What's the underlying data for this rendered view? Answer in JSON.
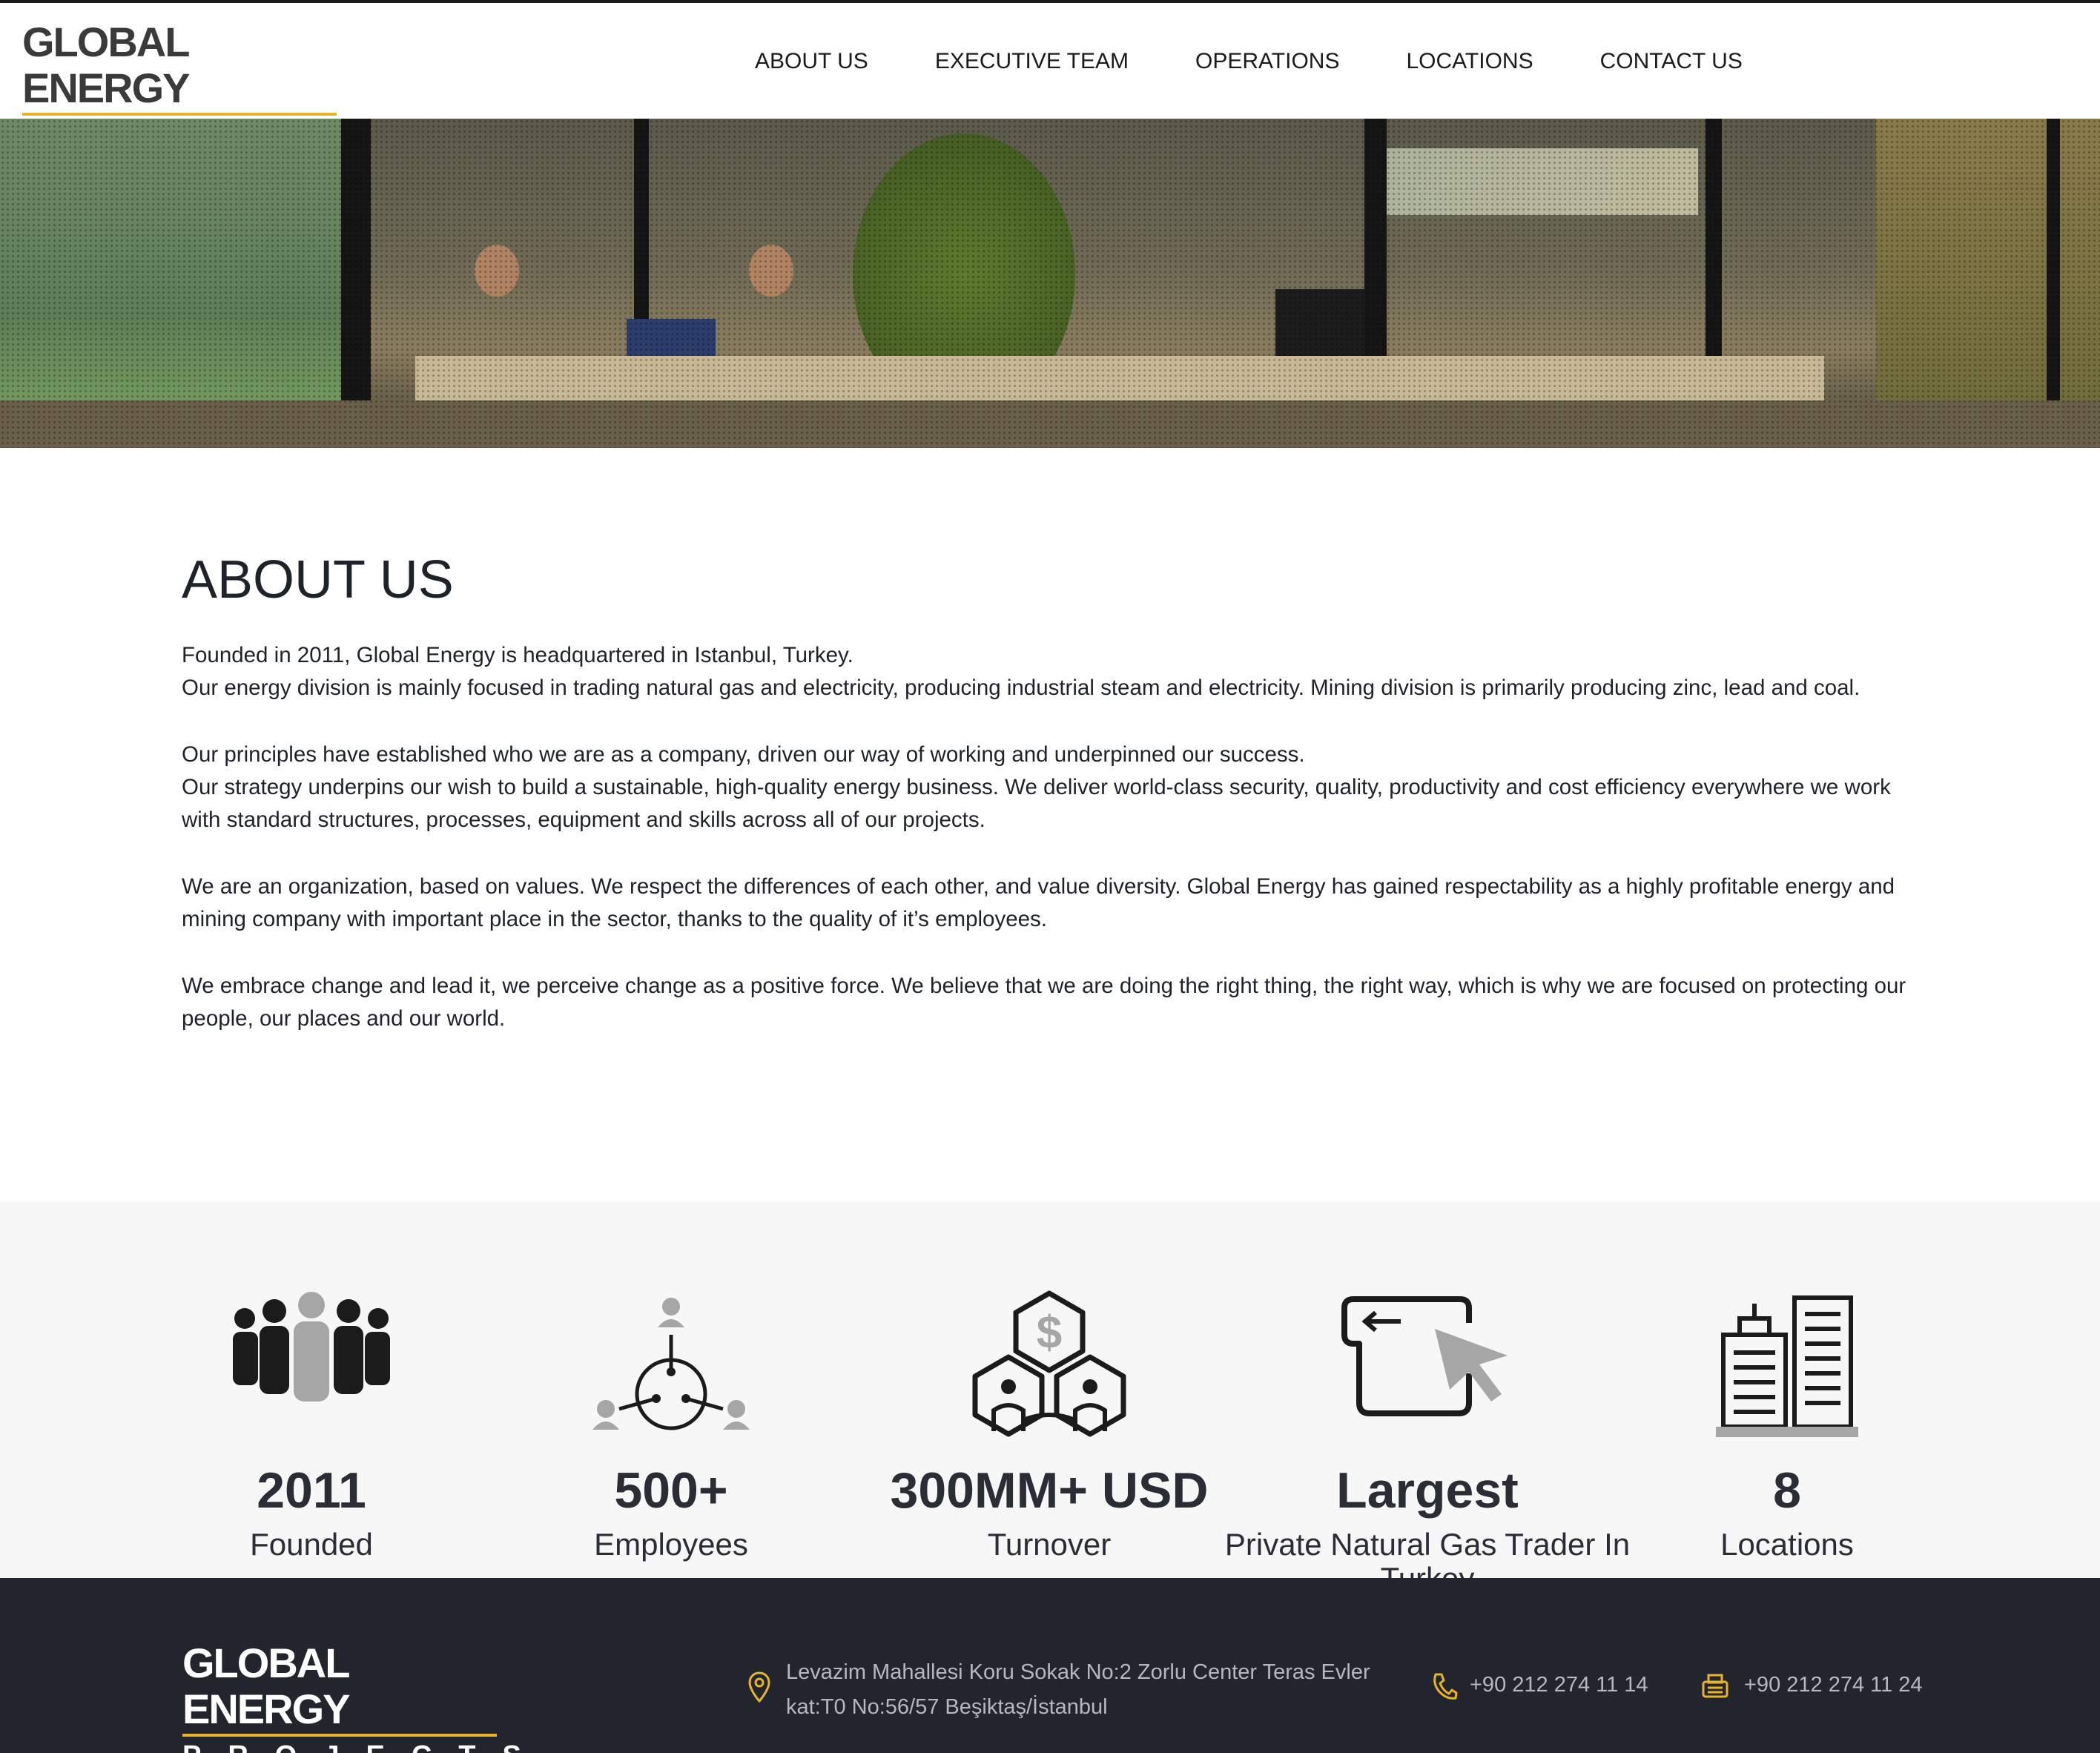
{
  "brand": {
    "line1": "GLOBAL ENERGY",
    "line2": "PROJECTS",
    "accent_color": "#e8b32a"
  },
  "nav": {
    "items": [
      {
        "label": "ABOUT US"
      },
      {
        "label": "EXECUTIVE TEAM"
      },
      {
        "label": "OPERATIONS"
      },
      {
        "label": "LOCATIONS"
      },
      {
        "label": "CONTACT US"
      }
    ]
  },
  "about": {
    "title": "ABOUT US",
    "paragraphs": [
      "Founded in 2011, Global Energy is headquartered in Istanbul, Turkey.",
      "Our energy division is mainly focused in trading natural gas and electricity, producing industrial steam and electricity. Mining division is primarily producing zinc, lead and coal.",
      "Our principles have established who we are as a company, driven our way of working and underpinned our success.",
      "Our strategy underpins our wish to build a sustainable, high-quality energy business. We deliver world-class security, quality, productivity and cost efficiency everywhere we work with standard structures, processes, equipment and skills across all of our projects.",
      "We are an organization, based on values. We respect the differences of each other, and value diversity. Global Energy has gained respectability as a highly profitable energy and mining company with important place in the sector, thanks to the quality of it’s employees.",
      "We embrace change and lead it, we perceive change as a positive force. We believe that we are doing the right thing, the right way, which is why we are focused on protecting our people, our places and our world."
    ]
  },
  "stats": [
    {
      "value": "2011",
      "label": "Founded",
      "icon": "group-icon"
    },
    {
      "value": "500+",
      "label": "Employees",
      "icon": "network-people-icon"
    },
    {
      "value": "300MM+ USD",
      "label": "Turnover",
      "icon": "dollar-partnership-icon"
    },
    {
      "value": "Largest",
      "label": "Private Natural Gas Trader In Turkey",
      "icon": "tablet-cursor-icon"
    },
    {
      "value": "8",
      "label": "Locations",
      "icon": "buildings-icon"
    }
  ],
  "footer": {
    "address_line1": "Levazim Mahallesi Koru Sokak No:2 Zorlu Center Teras Evler",
    "address_line2": "kat:T0 No:56/57 Beşiktaş/İstanbul",
    "phone": "+90 212 274 11 14",
    "fax": "+90 212 274 11 24"
  },
  "colors": {
    "footer_bg": "#22252e",
    "stats_bg": "#f7f7f7",
    "icon_dark": "#1b1b1b",
    "icon_gray": "#a6a6a6"
  }
}
